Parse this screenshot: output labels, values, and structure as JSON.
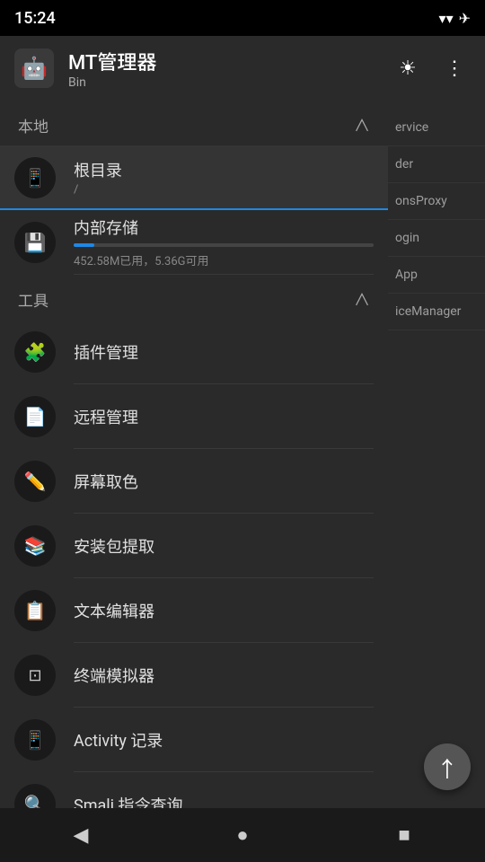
{
  "statusBar": {
    "time": "15:24",
    "icons": [
      "wifi",
      "airplane"
    ]
  },
  "appBar": {
    "title": "MT管理器",
    "subtitle": "Bin",
    "brightnessIcon": "☀",
    "moreIcon": "⋮"
  },
  "drawer": {
    "localSection": {
      "title": "本地",
      "chevron": "∧"
    },
    "localItems": [
      {
        "id": "root",
        "icon": "📱",
        "label": "根目录",
        "sub": "/"
      },
      {
        "id": "internal",
        "icon": "💾",
        "label": "内部存储",
        "sub": "452.58M已用，5.36G可用",
        "progress": 7,
        "progressLabel": "7%"
      }
    ],
    "toolSection": {
      "title": "工具",
      "chevron": "∧"
    },
    "toolItems": [
      {
        "id": "plugin",
        "icon": "🧩",
        "label": "插件管理"
      },
      {
        "id": "remote",
        "icon": "📄",
        "label": "远程管理"
      },
      {
        "id": "colorpicker",
        "icon": "✏",
        "label": "屏幕取色"
      },
      {
        "id": "apkextract",
        "icon": "📚",
        "label": "安装包提取"
      },
      {
        "id": "texteditor",
        "icon": "📋",
        "label": "文本编辑器"
      },
      {
        "id": "terminal",
        "icon": "⊡",
        "label": "终端模拟器"
      },
      {
        "id": "activity",
        "icon": "📱",
        "label": "Activity 记录"
      },
      {
        "id": "smali",
        "icon": "🔍",
        "label": "Smali 指令查询"
      }
    ]
  },
  "rightPanel": {
    "items": [
      "ervice",
      "der",
      "onsProxy",
      "ogin",
      "App",
      "iceManager"
    ]
  },
  "fab": {
    "icon": "↑"
  },
  "navBar": {
    "back": "◀",
    "home": "●",
    "recent": "■"
  }
}
